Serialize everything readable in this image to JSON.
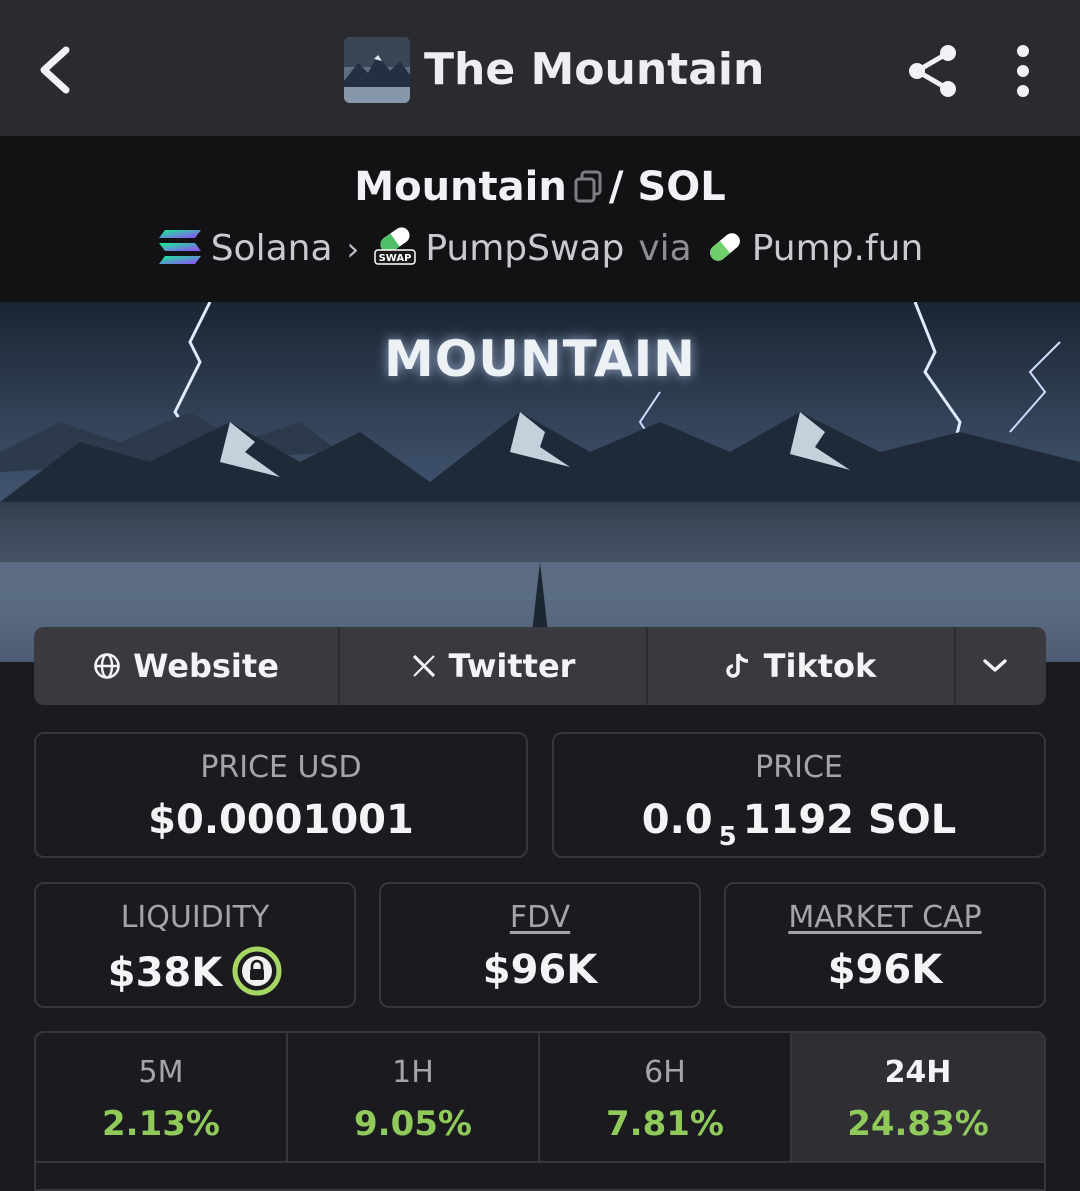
{
  "header": {
    "title": "The Mountain"
  },
  "pair": {
    "base": "Mountain",
    "separator": "/",
    "quote": "SOL",
    "chain": "Solana",
    "dex": "PumpSwap",
    "via_label": "via",
    "launchpad": "Pump.fun",
    "dex_badge": "SWAP"
  },
  "banner": {
    "title": "MOUNTAIN"
  },
  "links": {
    "website": "Website",
    "twitter": "Twitter",
    "tiktok": "Tiktok"
  },
  "stats": {
    "price_usd_label": "PRICE USD",
    "price_usd_value": "$0.0001001",
    "price_label": "PRICE",
    "price_value_prefix": "0.0",
    "price_value_zeros": "5",
    "price_value_suffix": "1192 SOL",
    "liquidity_label": "LIQUIDITY",
    "liquidity_value": "$38K",
    "fdv_label": "FDV",
    "fdv_value": "$96K",
    "mcap_label": "MARKET CAP",
    "mcap_value": "$96K"
  },
  "timeframes": [
    {
      "label": "5M",
      "change": "2.13%"
    },
    {
      "label": "1H",
      "change": "9.05%"
    },
    {
      "label": "6H",
      "change": "7.81%"
    },
    {
      "label": "24H",
      "change": "24.83%"
    }
  ],
  "colors": {
    "positive": "#8fca5a",
    "lock_ring": "#a6d663",
    "solana_gradient": [
      "#14f195",
      "#9945ff"
    ],
    "pill_green": "#7cd36a"
  },
  "icons": {
    "back": "chevron-left-icon",
    "share": "share-icon",
    "more": "more-vertical-icon",
    "copy": "copy-icon",
    "globe": "globe-icon",
    "x": "x-logo-icon",
    "tiktok": "tiktok-icon",
    "expand": "chevron-down-icon",
    "lock": "lock-icon"
  }
}
